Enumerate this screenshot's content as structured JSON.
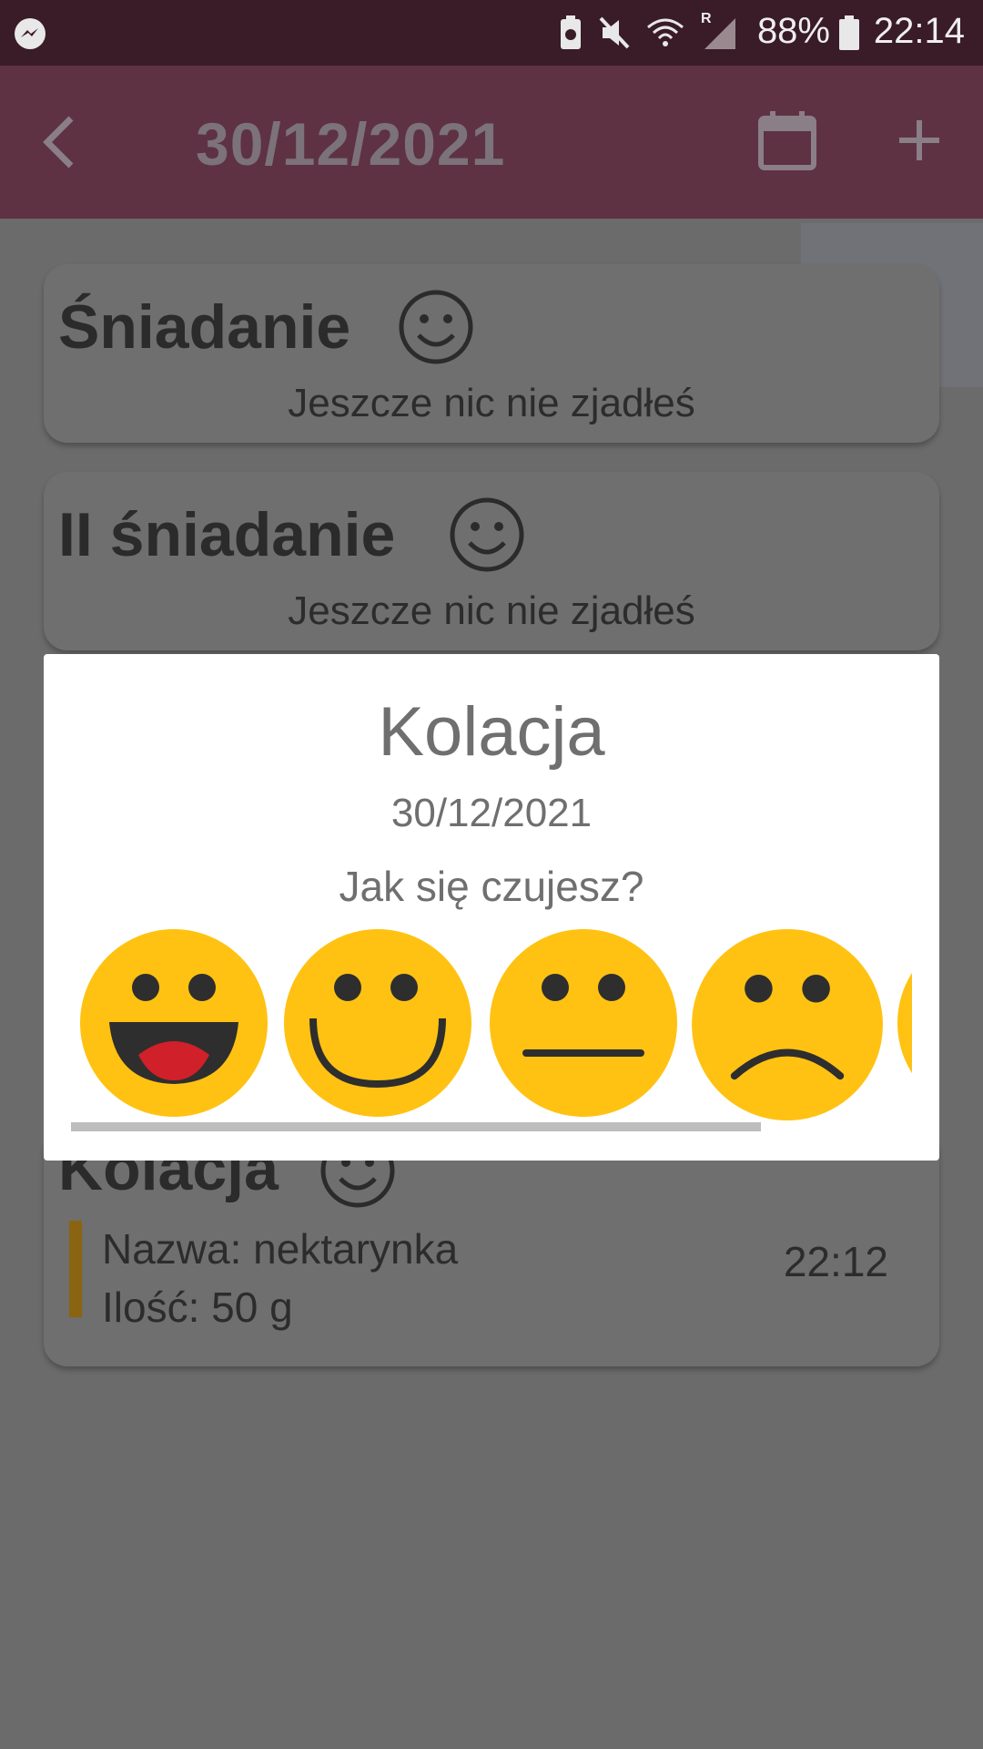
{
  "status_bar": {
    "battery_percent": "88%",
    "time": "22:14",
    "icons": [
      "messenger-icon",
      "battery-saver-icon",
      "mute-icon",
      "wifi-icon",
      "signal-icon",
      "battery-icon"
    ],
    "roaming_label": "R"
  },
  "app_bar": {
    "title": "30/12/2021",
    "back_icon": "chevron-left-icon",
    "calendar_icon": "calendar-icon",
    "add_icon": "plus-icon"
  },
  "meals": [
    {
      "name": "Śniadanie",
      "status": "Jeszcze nic nie zjadłeś"
    },
    {
      "name": "II śniadanie",
      "status": "Jeszcze nic nie zjadłeś"
    },
    {
      "name": "Kolacja",
      "entry": {
        "name_line": "Nazwa: nektarynka",
        "qty_line": "Ilość: 50 g",
        "time": "22:12"
      }
    }
  ],
  "dialog": {
    "title": "Kolacja",
    "date": "30/12/2021",
    "question": "Jak się czujesz?",
    "moods": [
      "very-happy",
      "happy",
      "neutral",
      "sad",
      "partial"
    ],
    "colors": {
      "emoji_fill": "#FFC212",
      "emoji_feature": "#2e2e2e",
      "tongue": "#D0202A"
    }
  },
  "colors": {
    "status_bar_bg": "#3a1b28",
    "app_bar_bg": "#5e3242",
    "overlay_bg": "#6b6b6b",
    "dialog_bg": "#ffffff"
  }
}
